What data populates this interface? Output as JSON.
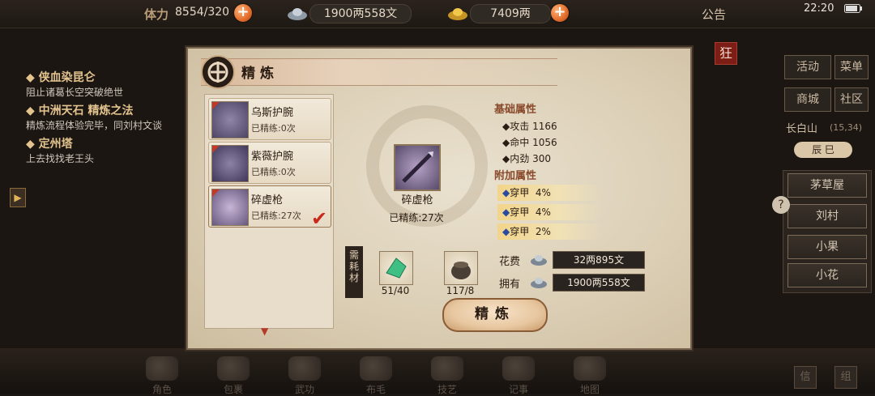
{
  "top_bar": {
    "stamina_label": "体力",
    "stamina_value": "8554/320",
    "silver_value": "1900两558文",
    "gold_value": "7409两",
    "announcement": "公告",
    "clock": "22:20"
  },
  "quests": [
    {
      "title": "◆ 侠血染昆仑",
      "desc": "阻止诸葛长空突破绝世"
    },
    {
      "title": "◆ 中洲天石 精炼之法",
      "desc": "精炼流程体验完毕，同刘村文谈"
    },
    {
      "title": "◆ 定州塔",
      "desc": "上去找找老王头"
    }
  ],
  "side_menu": {
    "row1": [
      "活动",
      "菜单"
    ],
    "row2": [
      "商城",
      "社区"
    ],
    "location": "长白山",
    "coords": "(15,34)",
    "time_tag": "辰 巳",
    "npcs": [
      "茅草屋",
      "刘村",
      "小果",
      "小花"
    ],
    "close_tag": "狂"
  },
  "bottom_bar": [
    "角色",
    "包裹",
    "武功",
    "布毛",
    "技艺",
    "记事",
    "地图",
    "信",
    "组"
  ],
  "dialog": {
    "title": "精炼",
    "items": [
      {
        "name": "乌斯护腕",
        "count": "已精练:0次"
      },
      {
        "name": "紫薇护腕",
        "count": "已精练:0次"
      },
      {
        "name": "碎虚枪",
        "count": "已精练:27次"
      }
    ],
    "selected": {
      "name": "碎虚枪",
      "count": "已精练:27次"
    },
    "base_attr_title": "基础属性",
    "base_attrs": [
      {
        "label": "◆攻击",
        "value": "1166"
      },
      {
        "label": "◆命中",
        "value": "1056"
      },
      {
        "label": "◆内劲",
        "value": "300"
      }
    ],
    "extra_attr_title": "附加属性",
    "extra_attrs": [
      {
        "label": "穿甲",
        "value": "4%"
      },
      {
        "label": "穿甲",
        "value": "4%"
      },
      {
        "label": "穿甲",
        "value": "2%"
      }
    ],
    "material_tag": "需耗材",
    "materials": [
      {
        "icon": "green-jade-icon",
        "count": "51/40"
      },
      {
        "icon": "stone-pot-icon",
        "count": "117/8"
      }
    ],
    "cost_label": "花费",
    "cost_value": "32两895文",
    "own_label": "拥有",
    "own_value": "1900两558文",
    "refine_button": "精炼"
  }
}
